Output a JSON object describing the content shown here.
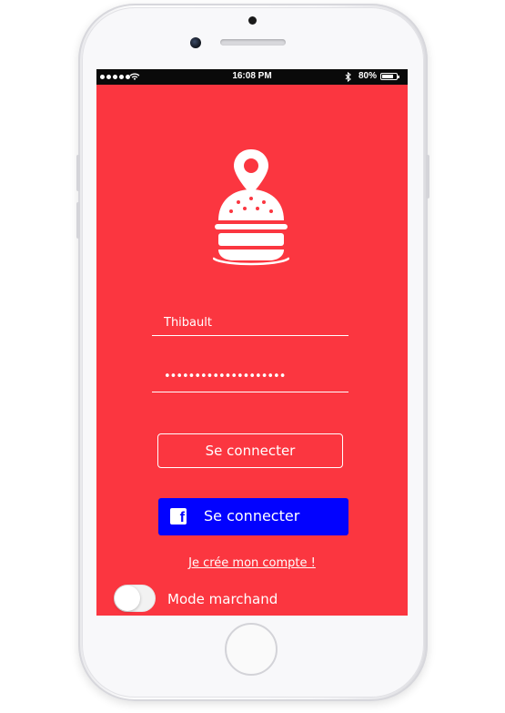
{
  "status_bar": {
    "time": "16:08 PM",
    "battery": "80%",
    "battery_level": 0.8
  },
  "login": {
    "username_value": "Thibault",
    "password_mask": "••••••••••••••••••••",
    "connect_label": "Se connecter",
    "facebook_label": "Se connecter",
    "signup_label": "Je crée mon compte !",
    "merchant_mode_label": "Mode marchand",
    "merchant_mode_on": false
  },
  "icons": {
    "logo": "burger-location-pin-icon",
    "facebook": "facebook-icon"
  },
  "colors": {
    "background": "#fb3640",
    "facebook_button": "#0202ff",
    "text": "#ffffff"
  }
}
